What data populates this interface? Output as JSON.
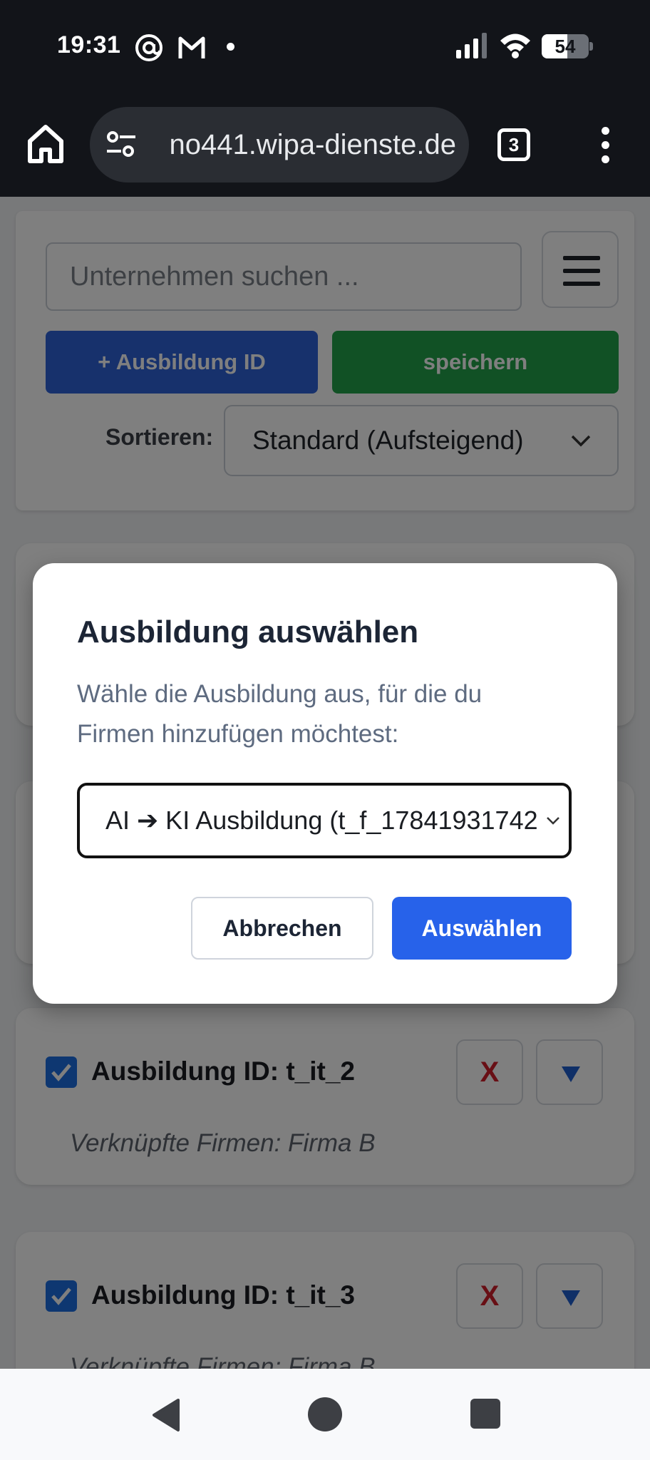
{
  "status_bar": {
    "time": "19:31",
    "battery_level": "54",
    "icons": [
      "at-sign-icon",
      "gmail-icon",
      "notification-dot-icon",
      "signal-icon",
      "wifi-icon",
      "battery-icon"
    ]
  },
  "browser": {
    "url": "no441.wipa-dienste.de",
    "tab_count": "3",
    "icons": [
      "home-icon",
      "site-settings-icon",
      "tabs-icon",
      "more-vert-icon"
    ]
  },
  "toolbar": {
    "search_placeholder": "Unternehmen suchen ...",
    "add_button": "+ Ausbildung ID",
    "save_button": "speichern",
    "sort_label": "Sortieren:",
    "sort_value": "Standard (Aufsteigend)"
  },
  "items": [
    {
      "title": "Ausbildung ID: t_it_2",
      "subtitle": "Verknüpfte Firmen: Firma B",
      "checked": true,
      "delete_label": "X"
    },
    {
      "title": "Ausbildung ID: t_it_3",
      "subtitle": "Verknüpfte Firmen: Firma B",
      "checked": true,
      "delete_label": "X"
    }
  ],
  "modal": {
    "title": "Ausbildung auswählen",
    "text": "Wähle die Ausbildung aus, für die du Firmen hinzufügen möchtest:",
    "select_value": "AI ➔ KI Ausbildung (t_f_17841931742",
    "cancel": "Abbrechen",
    "confirm": "Auswählen"
  },
  "colors": {
    "add_button": "#2e62d8",
    "save_button": "#22a34a",
    "confirm_button": "#2762ea",
    "delete_x": "#d11e2a",
    "checkbox": "#1c6fe3"
  }
}
